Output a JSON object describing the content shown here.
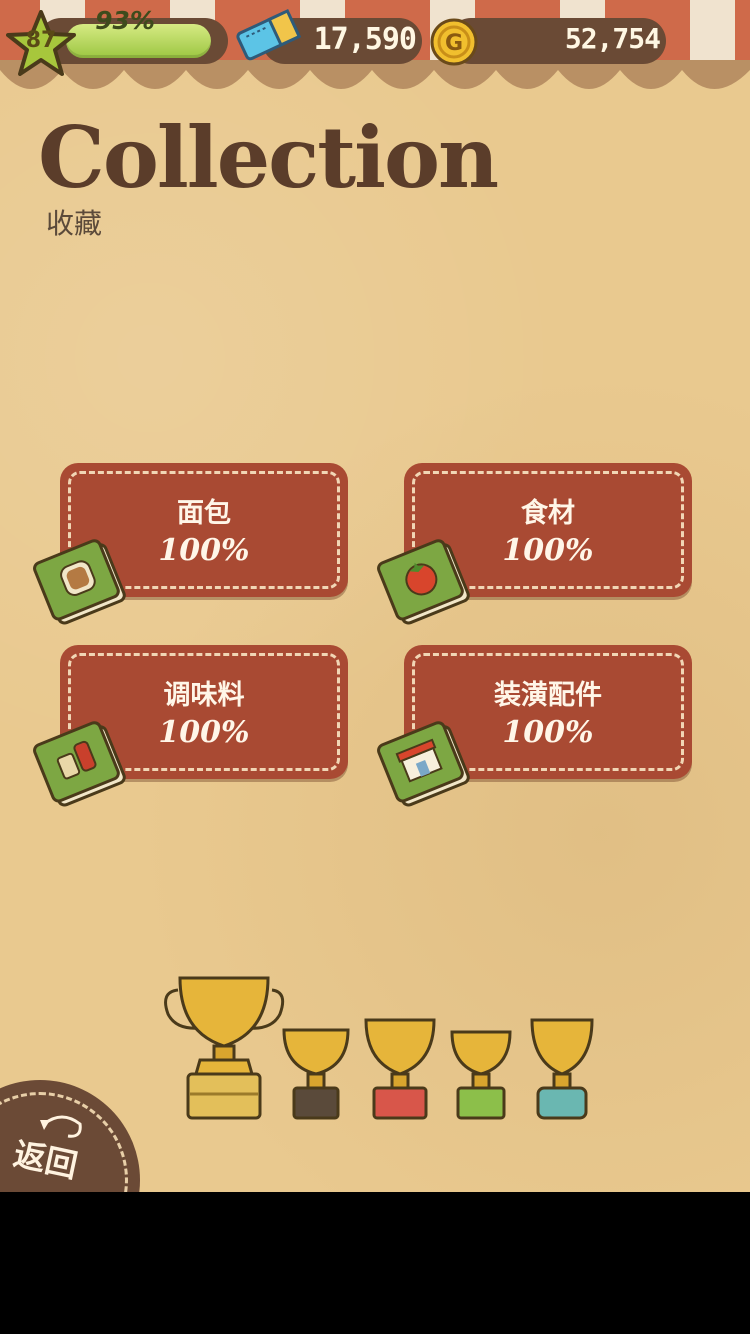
{
  "hud": {
    "level": "87",
    "level_progress_label": "93%",
    "level_progress": 0.93,
    "tickets": "17,590",
    "coins": "52,754"
  },
  "header": {
    "title": "Collection",
    "subtitle": "收藏"
  },
  "categories": [
    {
      "label": "面包",
      "percent": "100%",
      "icon": "bread-book-icon"
    },
    {
      "label": "食材",
      "percent": "100%",
      "icon": "tomato-book-icon"
    },
    {
      "label": "调味料",
      "percent": "100%",
      "icon": "condiment-book-icon"
    },
    {
      "label": "装潢配件",
      "percent": "100%",
      "icon": "shop-book-icon"
    }
  ],
  "trophies": [
    "gold-trophy-large",
    "trophy-black-base",
    "trophy-red-base",
    "trophy-green-base",
    "trophy-blue-base"
  ],
  "back_button": {
    "label": "返回"
  },
  "colors": {
    "background": "#e9c98f",
    "card": "#a94a33",
    "hud": "#6a4a35",
    "title": "#5b3d2a",
    "level_fill": "#9cc642"
  }
}
